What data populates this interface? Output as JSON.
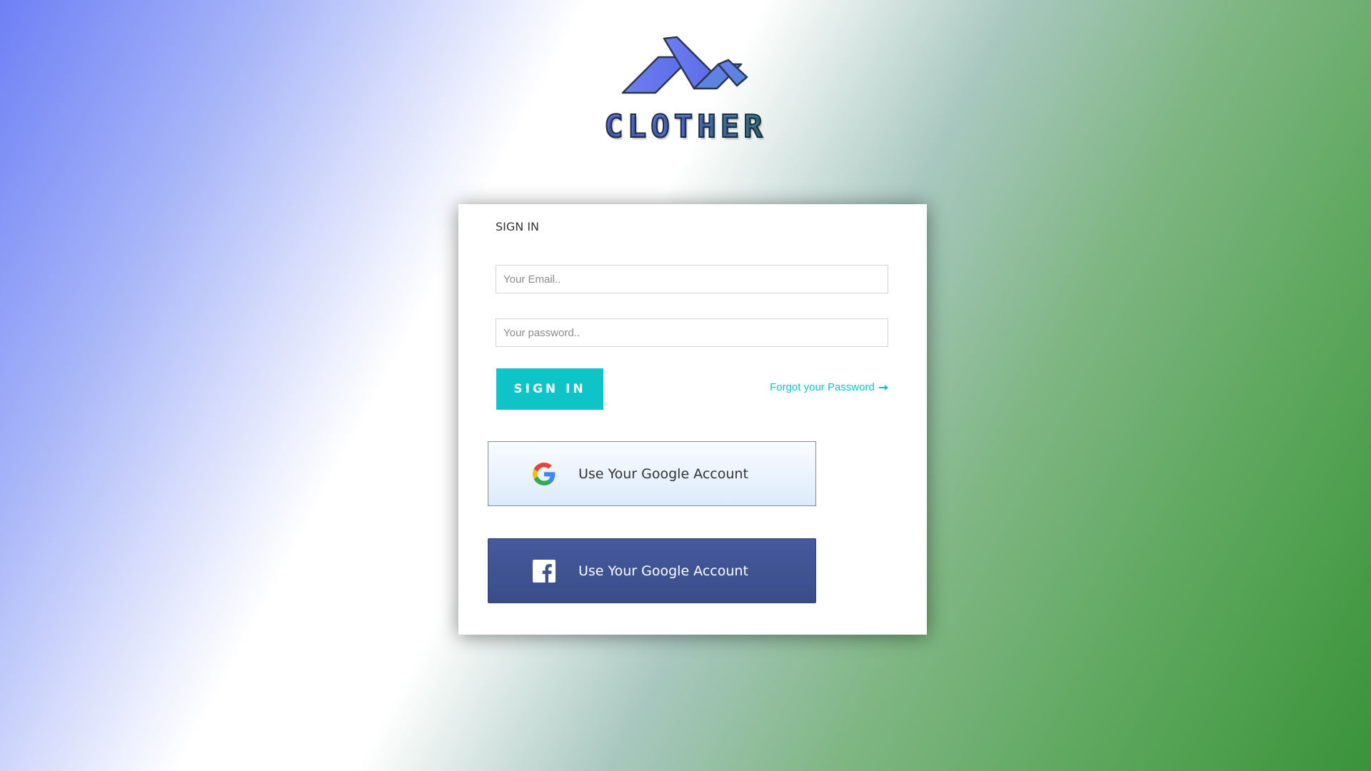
{
  "brand": {
    "name": "CLOTHER",
    "logo_icon": "clother-logo-icon"
  },
  "card": {
    "title": "SIGN IN",
    "email_placeholder": "Your Email..",
    "password_placeholder": "Your password..",
    "signin_label": "SIGN IN",
    "forgot_label": "Forgot your Password",
    "forgot_icon": "arrow-right-icon",
    "google": {
      "label": "Use Your Google Account",
      "icon": "google-icon"
    },
    "facebook": {
      "label": "Use Your Google Account",
      "icon": "facebook-icon"
    }
  },
  "colors": {
    "accent": "#0fc4c6",
    "facebook_blue": "#3d5190",
    "logo_blue": "#5f79e8"
  }
}
